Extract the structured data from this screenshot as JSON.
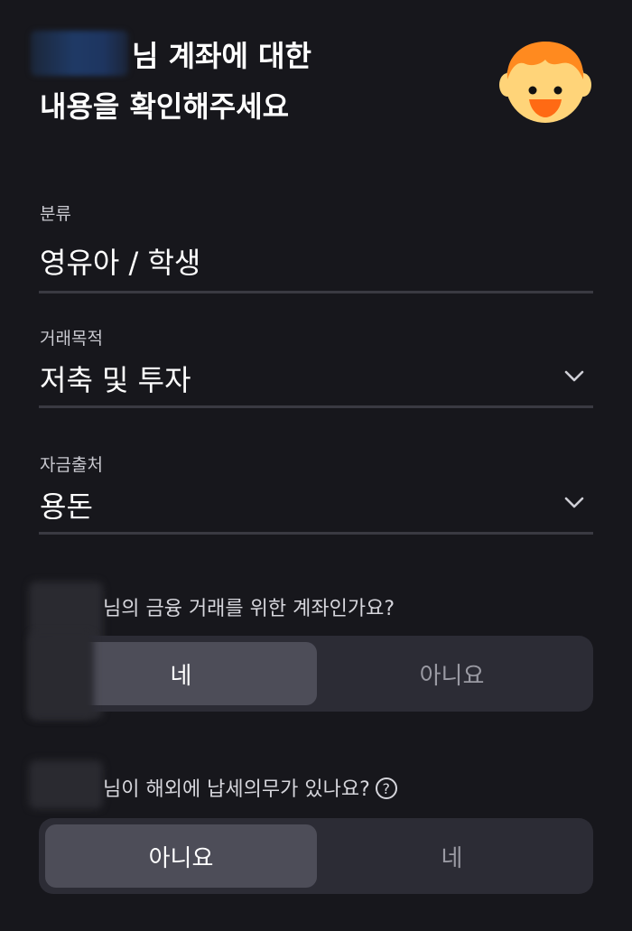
{
  "header": {
    "title_line1_suffix": "님 계좌에 대한",
    "title_line2": "내용을 확인해주세요"
  },
  "fields": {
    "category": {
      "label": "분류",
      "value": "영유아 / 학생"
    },
    "purpose": {
      "label": "거래목적",
      "value": "저축 및 투자"
    },
    "source": {
      "label": "자금출처",
      "value": "용돈"
    }
  },
  "questions": {
    "own_account": {
      "text": "님의 금융 거래를 위한 계좌인가요?",
      "options": [
        "네",
        "아니요"
      ],
      "selected": "네"
    },
    "overseas_tax": {
      "text": "님이 해외에 납세의무가 있나요?",
      "help_icon": "?",
      "options": [
        "아니요",
        "네"
      ],
      "selected": "아니요"
    }
  },
  "colors": {
    "background": "#17171c",
    "segment_bg": "#2c2c35",
    "segment_selected": "#4d4d58",
    "avatar_face": "#ffd479",
    "avatar_hair": "#ff8a1f",
    "avatar_mouth": "#ff6a14"
  }
}
